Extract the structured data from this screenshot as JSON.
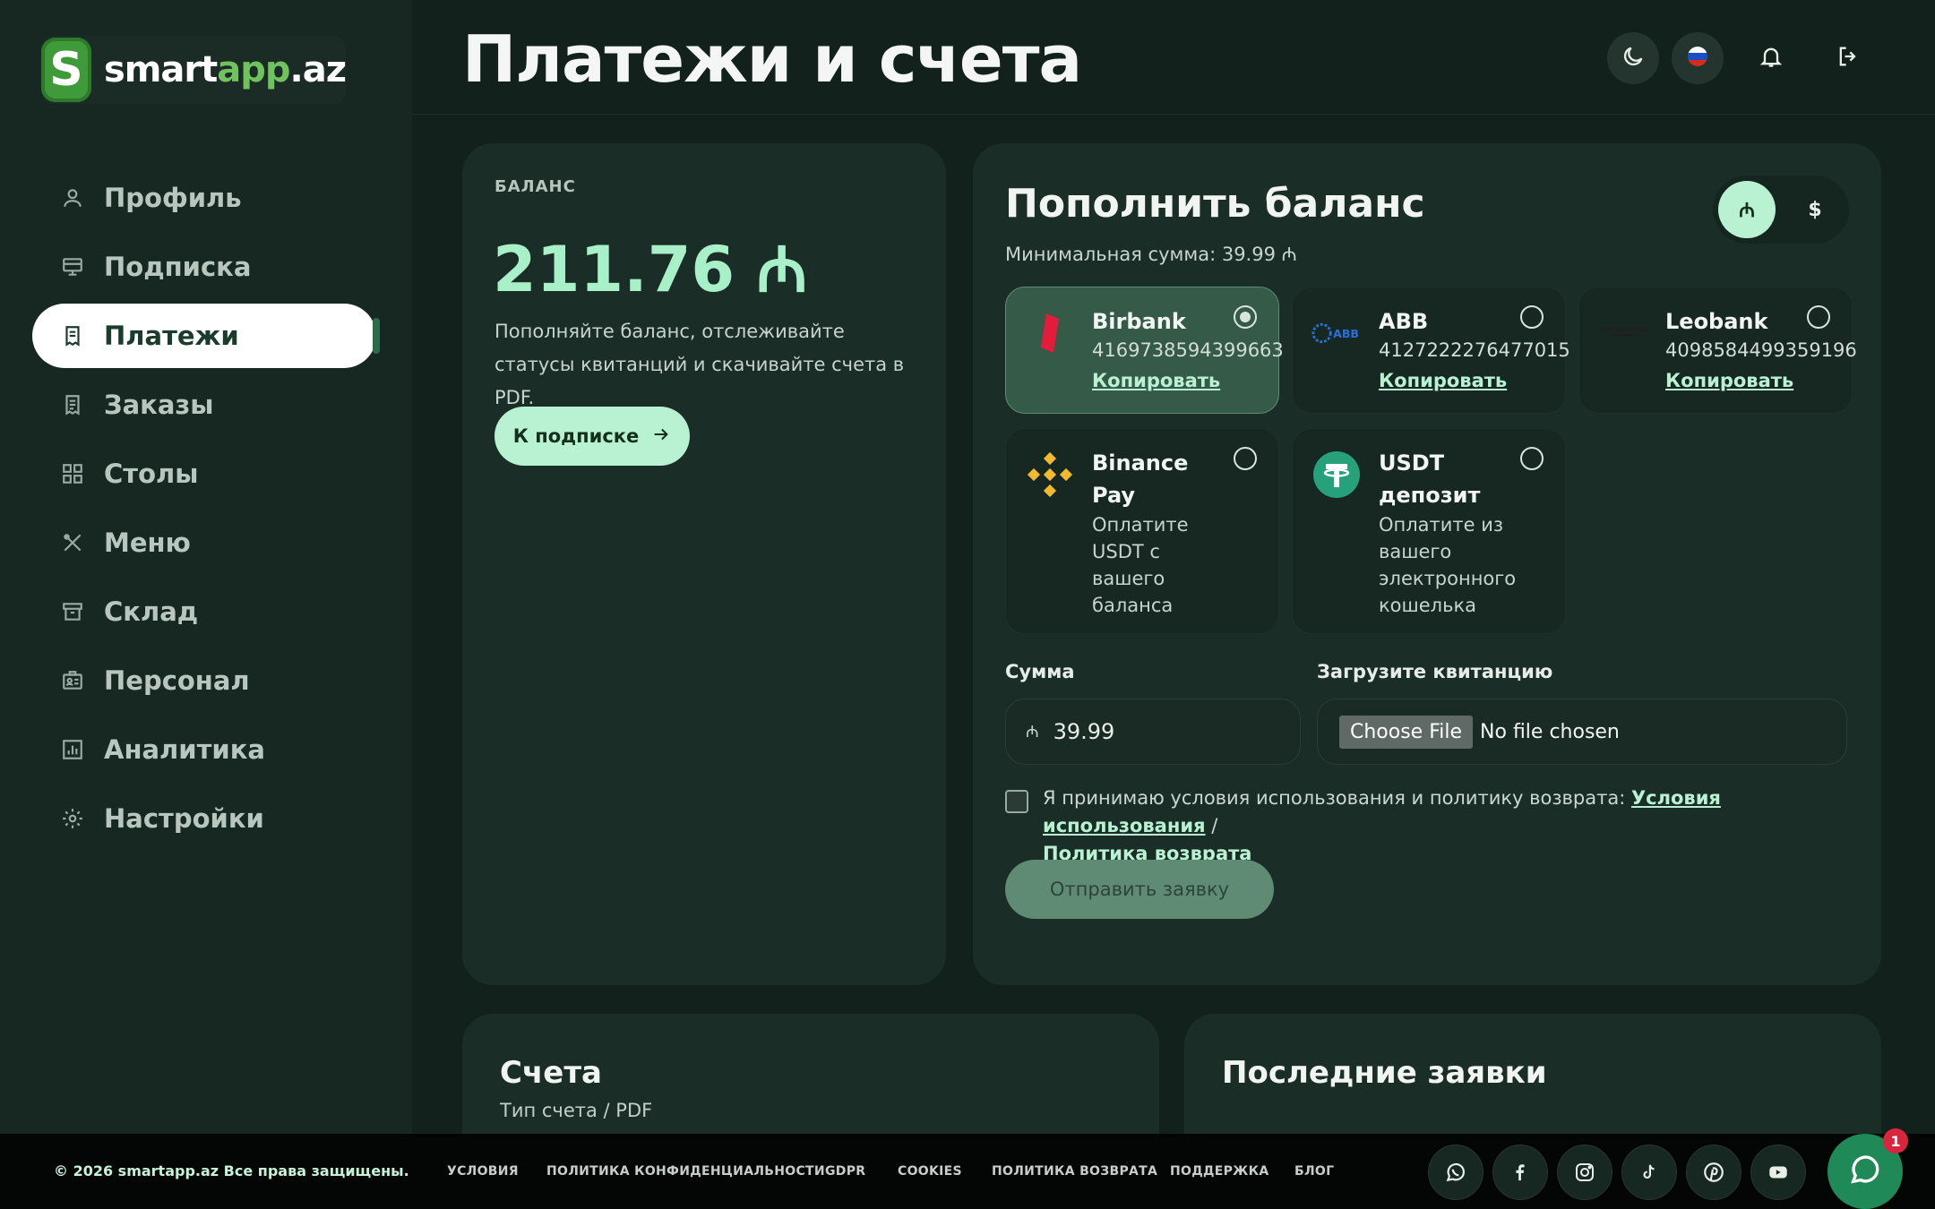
{
  "brand": {
    "name_part1": "smart",
    "name_part2": "app",
    "name_part3": ".az"
  },
  "page": {
    "title": "Платежи и счета"
  },
  "sidebar": {
    "items": [
      {
        "label": "Профиль",
        "icon": "user-icon"
      },
      {
        "label": "Подписка",
        "icon": "subscription-icon"
      },
      {
        "label": "Платежи",
        "icon": "receipt-icon",
        "active": true
      },
      {
        "label": "Заказы",
        "icon": "orders-icon"
      },
      {
        "label": "Столы",
        "icon": "grid-icon"
      },
      {
        "label": "Меню",
        "icon": "utensils-icon"
      },
      {
        "label": "Склад",
        "icon": "archive-icon"
      },
      {
        "label": "Персонал",
        "icon": "id-card-icon"
      },
      {
        "label": "Аналитика",
        "icon": "chart-icon"
      },
      {
        "label": "Настройки",
        "icon": "gear-icon"
      }
    ]
  },
  "balance": {
    "label": "БАЛАНС",
    "amount": "211.76 ₼",
    "description": "Пополняйте баланс, отслеживайте статусы квитанций и скачивайте счета в PDF.",
    "button": "К подписке"
  },
  "topup": {
    "title": "Пополнить баланс",
    "min": "Минимальная сумма: 39.99 ₼",
    "currency_azn": "₼",
    "currency_usd": "$",
    "methods": [
      {
        "name": "Birbank",
        "number": "4169738594399663",
        "copy": "Копировать",
        "selected": true
      },
      {
        "name": "ABB",
        "number": "4127222276477015",
        "copy": "Копировать"
      },
      {
        "name": "Leobank",
        "number": "4098584499359196",
        "copy": "Копировать"
      },
      {
        "name_line1": "Binance",
        "name_line2": "Pay",
        "desc": "Оплатите USDT с вашего баланса"
      },
      {
        "name_line1": "USDT",
        "name_line2": "депозит",
        "desc": "Оплатите из вашего электронного кошелька"
      }
    ],
    "amount_label": "Сумма",
    "amount_currency": "₼",
    "amount_value": "39.99",
    "upload_label": "Загрузите квитанцию",
    "file_button": "Choose File",
    "file_status": "No file chosen",
    "terms_text": "Я принимаю условия использования и политику возврата:",
    "terms_link": "Условия использования",
    "terms_sep": "/",
    "refund_link": "Политика возврата",
    "submit": "Отправить заявку"
  },
  "invoices": {
    "title": "Счета",
    "subtitle": "Тип счета / PDF"
  },
  "requests": {
    "title": "Последние заявки"
  },
  "footer": {
    "copyright": "© 2026 smartapp.az Все права защищены.",
    "links": [
      "УСЛОВИЯ",
      "ПОЛИТИКА КОНФИДЕНЦИАЛЬНОСТИ",
      "GDPR",
      "COOKIES",
      "ПОЛИТИКА ВОЗВРАТА",
      "ПОДДЕРЖКА",
      "БЛОГ"
    ],
    "social": [
      "whatsapp-icon",
      "facebook-icon",
      "instagram-icon",
      "tiktok-icon",
      "pinterest-icon",
      "youtube-icon"
    ],
    "chat_badge": "1"
  }
}
